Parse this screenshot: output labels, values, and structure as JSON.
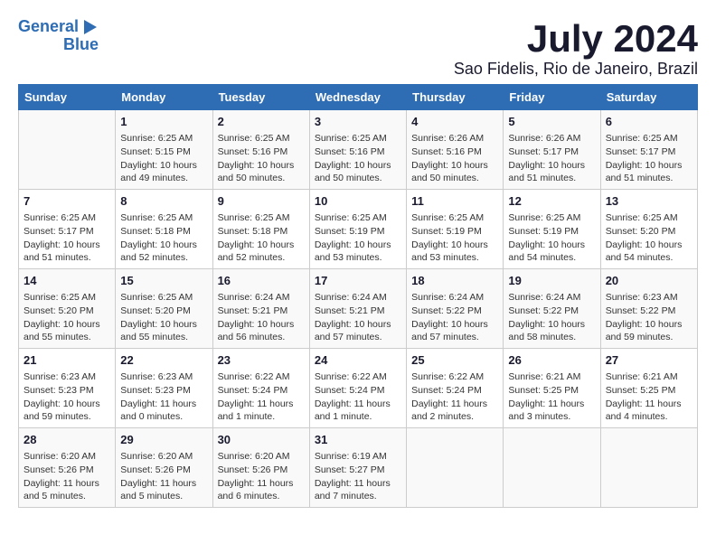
{
  "logo": {
    "line1": "General",
    "line2": "Blue"
  },
  "title": "July 2024",
  "subtitle": "Sao Fidelis, Rio de Janeiro, Brazil",
  "days_of_week": [
    "Sunday",
    "Monday",
    "Tuesday",
    "Wednesday",
    "Thursday",
    "Friday",
    "Saturday"
  ],
  "weeks": [
    [
      {
        "day": "",
        "info": ""
      },
      {
        "day": "1",
        "info": "Sunrise: 6:25 AM\nSunset: 5:15 PM\nDaylight: 10 hours\nand 49 minutes."
      },
      {
        "day": "2",
        "info": "Sunrise: 6:25 AM\nSunset: 5:16 PM\nDaylight: 10 hours\nand 50 minutes."
      },
      {
        "day": "3",
        "info": "Sunrise: 6:25 AM\nSunset: 5:16 PM\nDaylight: 10 hours\nand 50 minutes."
      },
      {
        "day": "4",
        "info": "Sunrise: 6:26 AM\nSunset: 5:16 PM\nDaylight: 10 hours\nand 50 minutes."
      },
      {
        "day": "5",
        "info": "Sunrise: 6:26 AM\nSunset: 5:17 PM\nDaylight: 10 hours\nand 51 minutes."
      },
      {
        "day": "6",
        "info": "Sunrise: 6:25 AM\nSunset: 5:17 PM\nDaylight: 10 hours\nand 51 minutes."
      }
    ],
    [
      {
        "day": "7",
        "info": "Sunrise: 6:25 AM\nSunset: 5:17 PM\nDaylight: 10 hours\nand 51 minutes."
      },
      {
        "day": "8",
        "info": "Sunrise: 6:25 AM\nSunset: 5:18 PM\nDaylight: 10 hours\nand 52 minutes."
      },
      {
        "day": "9",
        "info": "Sunrise: 6:25 AM\nSunset: 5:18 PM\nDaylight: 10 hours\nand 52 minutes."
      },
      {
        "day": "10",
        "info": "Sunrise: 6:25 AM\nSunset: 5:19 PM\nDaylight: 10 hours\nand 53 minutes."
      },
      {
        "day": "11",
        "info": "Sunrise: 6:25 AM\nSunset: 5:19 PM\nDaylight: 10 hours\nand 53 minutes."
      },
      {
        "day": "12",
        "info": "Sunrise: 6:25 AM\nSunset: 5:19 PM\nDaylight: 10 hours\nand 54 minutes."
      },
      {
        "day": "13",
        "info": "Sunrise: 6:25 AM\nSunset: 5:20 PM\nDaylight: 10 hours\nand 54 minutes."
      }
    ],
    [
      {
        "day": "14",
        "info": "Sunrise: 6:25 AM\nSunset: 5:20 PM\nDaylight: 10 hours\nand 55 minutes."
      },
      {
        "day": "15",
        "info": "Sunrise: 6:25 AM\nSunset: 5:20 PM\nDaylight: 10 hours\nand 55 minutes."
      },
      {
        "day": "16",
        "info": "Sunrise: 6:24 AM\nSunset: 5:21 PM\nDaylight: 10 hours\nand 56 minutes."
      },
      {
        "day": "17",
        "info": "Sunrise: 6:24 AM\nSunset: 5:21 PM\nDaylight: 10 hours\nand 57 minutes."
      },
      {
        "day": "18",
        "info": "Sunrise: 6:24 AM\nSunset: 5:22 PM\nDaylight: 10 hours\nand 57 minutes."
      },
      {
        "day": "19",
        "info": "Sunrise: 6:24 AM\nSunset: 5:22 PM\nDaylight: 10 hours\nand 58 minutes."
      },
      {
        "day": "20",
        "info": "Sunrise: 6:23 AM\nSunset: 5:22 PM\nDaylight: 10 hours\nand 59 minutes."
      }
    ],
    [
      {
        "day": "21",
        "info": "Sunrise: 6:23 AM\nSunset: 5:23 PM\nDaylight: 10 hours\nand 59 minutes."
      },
      {
        "day": "22",
        "info": "Sunrise: 6:23 AM\nSunset: 5:23 PM\nDaylight: 11 hours\nand 0 minutes."
      },
      {
        "day": "23",
        "info": "Sunrise: 6:22 AM\nSunset: 5:24 PM\nDaylight: 11 hours\nand 1 minute."
      },
      {
        "day": "24",
        "info": "Sunrise: 6:22 AM\nSunset: 5:24 PM\nDaylight: 11 hours\nand 1 minute."
      },
      {
        "day": "25",
        "info": "Sunrise: 6:22 AM\nSunset: 5:24 PM\nDaylight: 11 hours\nand 2 minutes."
      },
      {
        "day": "26",
        "info": "Sunrise: 6:21 AM\nSunset: 5:25 PM\nDaylight: 11 hours\nand 3 minutes."
      },
      {
        "day": "27",
        "info": "Sunrise: 6:21 AM\nSunset: 5:25 PM\nDaylight: 11 hours\nand 4 minutes."
      }
    ],
    [
      {
        "day": "28",
        "info": "Sunrise: 6:20 AM\nSunset: 5:26 PM\nDaylight: 11 hours\nand 5 minutes."
      },
      {
        "day": "29",
        "info": "Sunrise: 6:20 AM\nSunset: 5:26 PM\nDaylight: 11 hours\nand 5 minutes."
      },
      {
        "day": "30",
        "info": "Sunrise: 6:20 AM\nSunset: 5:26 PM\nDaylight: 11 hours\nand 6 minutes."
      },
      {
        "day": "31",
        "info": "Sunrise: 6:19 AM\nSunset: 5:27 PM\nDaylight: 11 hours\nand 7 minutes."
      },
      {
        "day": "",
        "info": ""
      },
      {
        "day": "",
        "info": ""
      },
      {
        "day": "",
        "info": ""
      }
    ]
  ]
}
